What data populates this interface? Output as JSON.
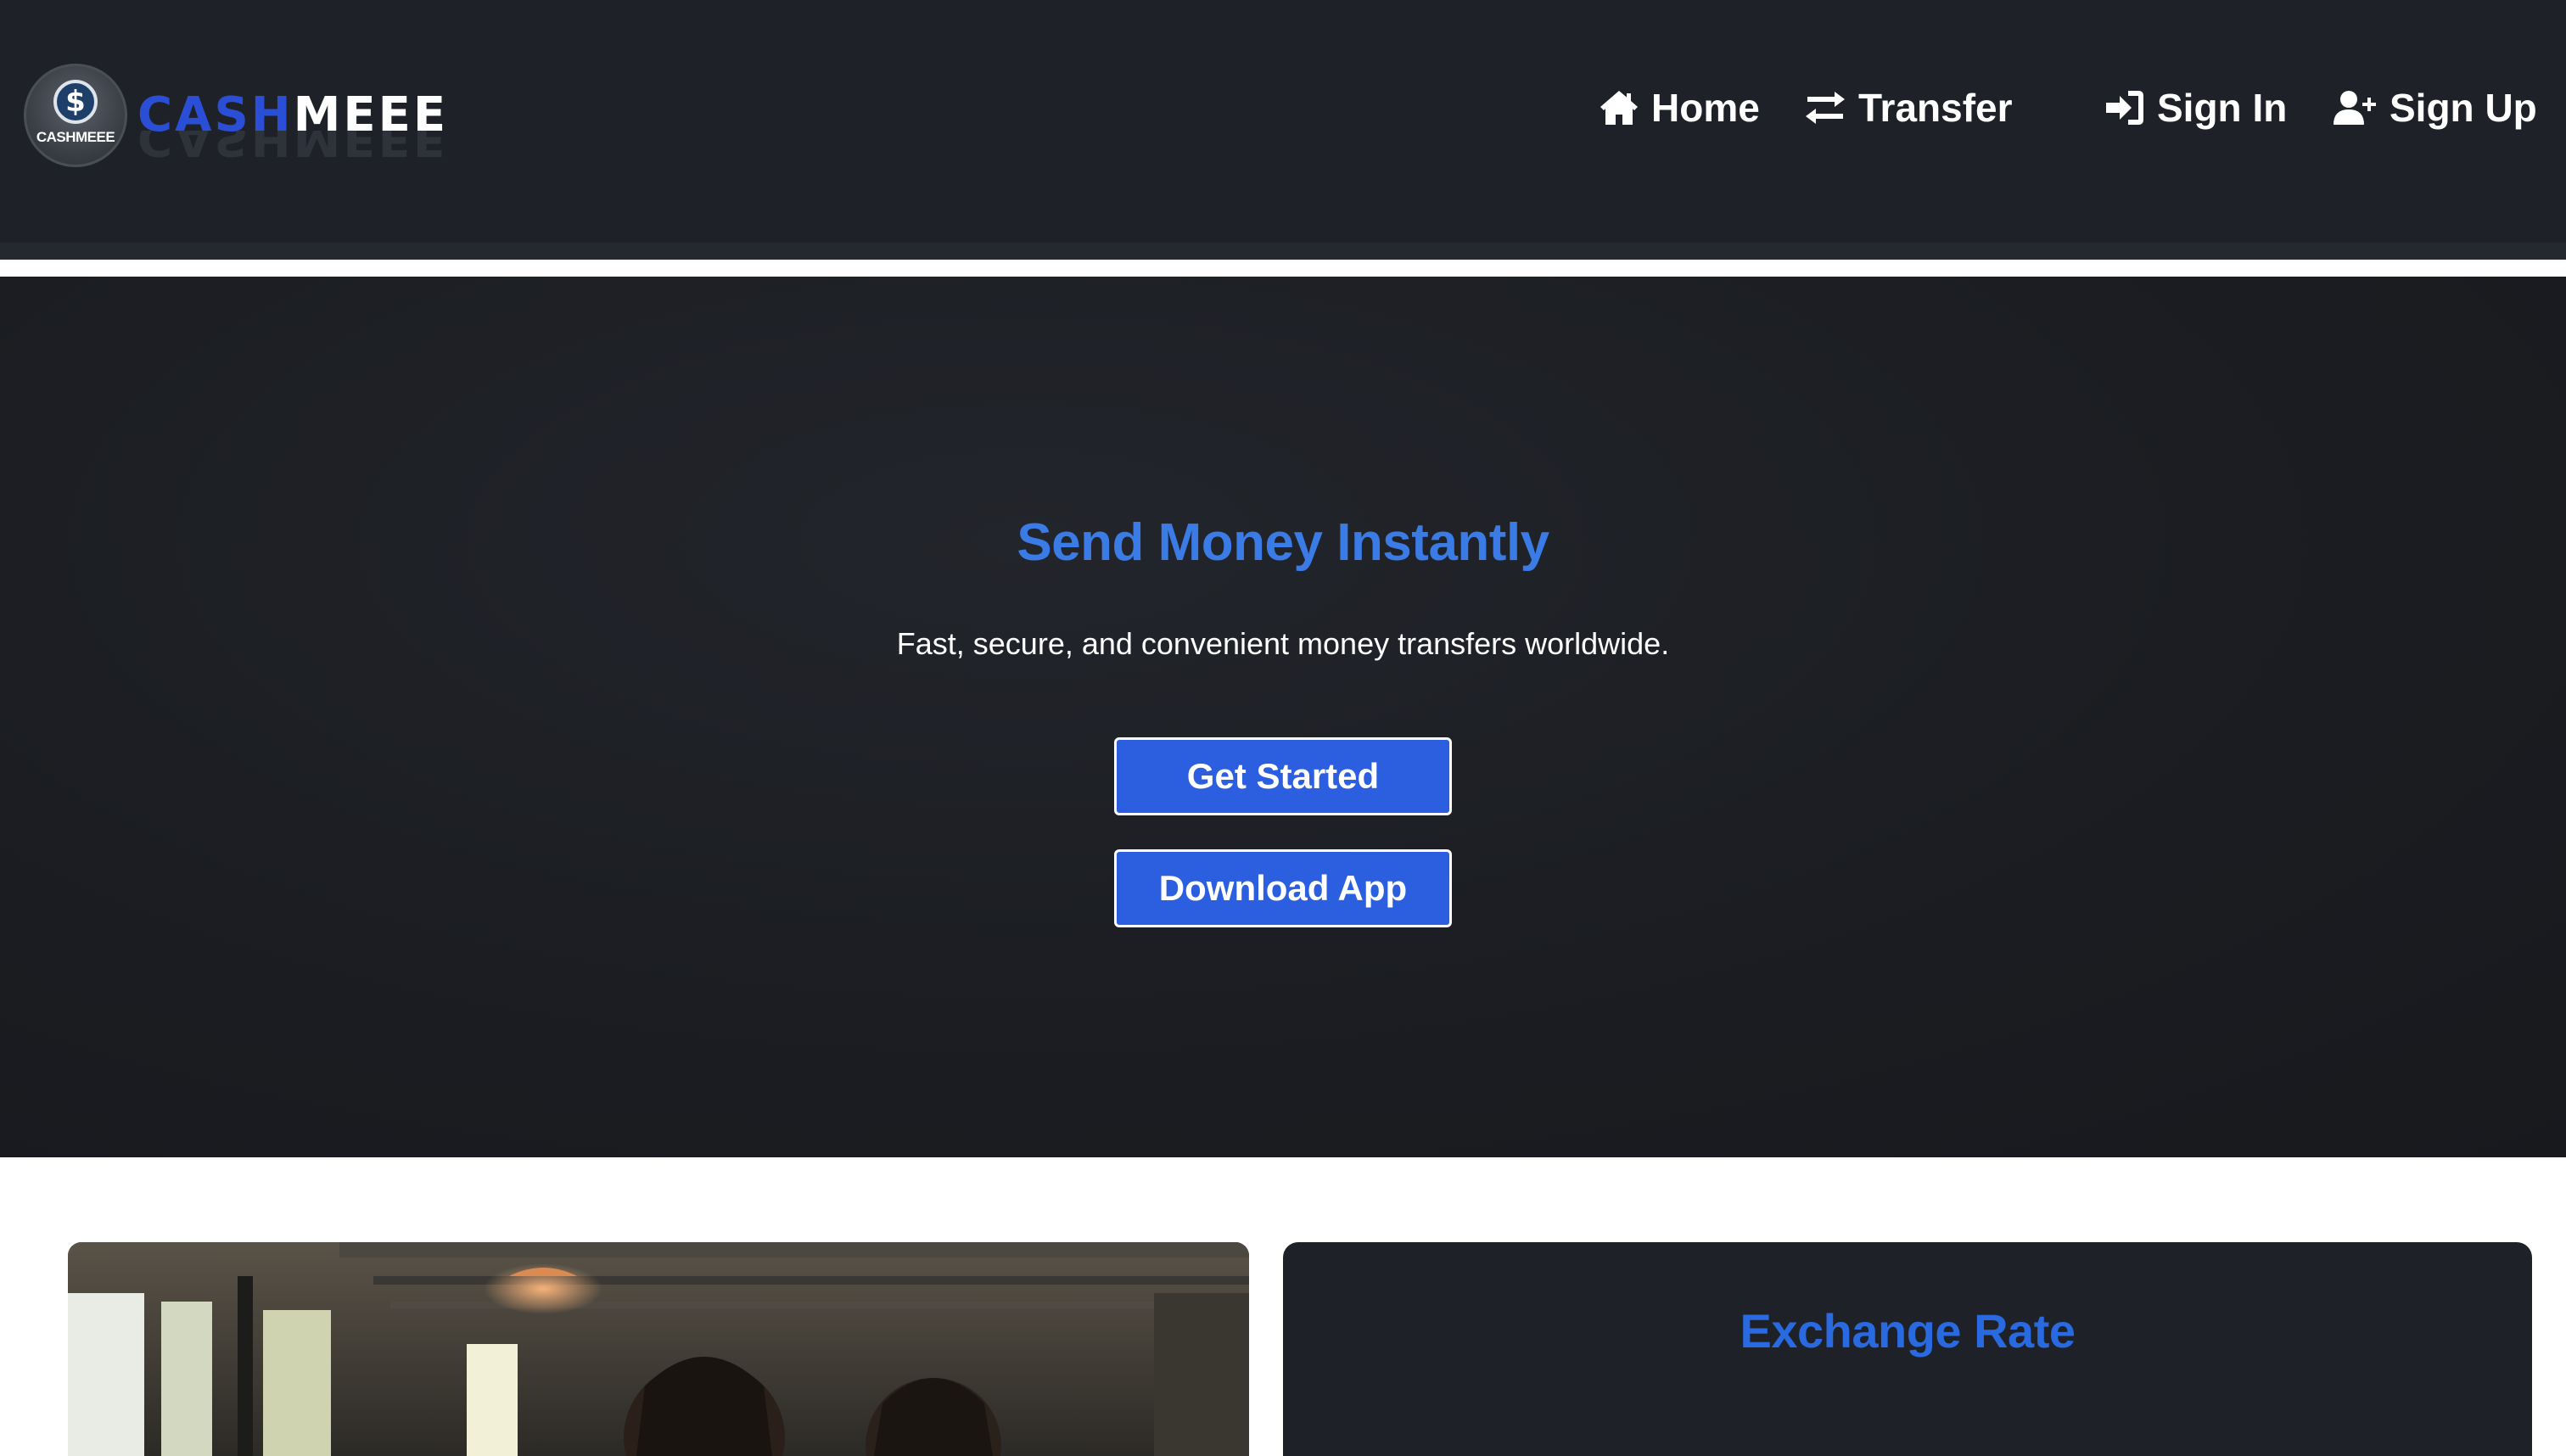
{
  "brand": {
    "logo_text": "CASHMEEE",
    "logo_symbol": "$",
    "name_part1": "CASH",
    "name_part2": "MEEE"
  },
  "nav": {
    "items": [
      {
        "label": "Home",
        "icon": "home-icon"
      },
      {
        "label": "Transfer",
        "icon": "transfer-arrows-icon"
      },
      {
        "label": "Sign In",
        "icon": "sign-in-icon"
      },
      {
        "label": "Sign Up",
        "icon": "user-plus-icon"
      }
    ]
  },
  "hero": {
    "title": "Send Money Instantly",
    "subtitle": "Fast, secure, and convenient money transfers worldwide.",
    "primary_button": "Get Started",
    "secondary_button": "Download App"
  },
  "exchange": {
    "title": "Exchange Rate"
  },
  "colors": {
    "header_bg": "#1e2128",
    "hero_bg": "#1b1d22",
    "accent_blue": "#2b5fe0",
    "title_blue": "#3b7be6",
    "text_white": "#ffffff"
  }
}
